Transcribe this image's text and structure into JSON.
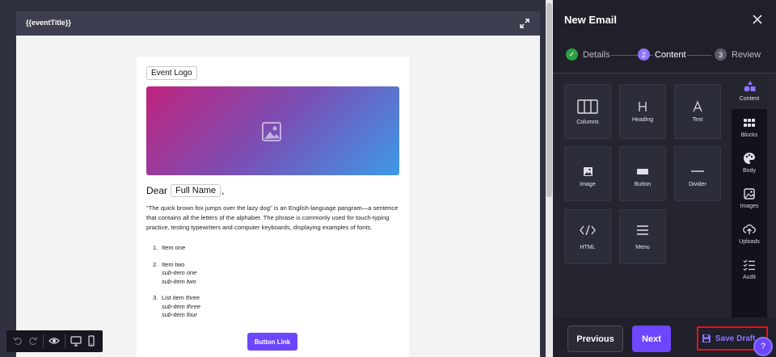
{
  "preview": {
    "title": "{{eventTitle}}",
    "logo_placeholder": "Event Logo",
    "greeting": "Dear",
    "name_placeholder": "Full Name",
    "greeting_suffix": ",",
    "paragraph": "\"The quick brown fox jumps over the lazy dog\" is an English-language pangram—a sentence that contains all the letters of the alphabet. The phrase is commonly used for touch-typing practice, testing typewriters and computer keyboards, displaying examples of fonts.",
    "list": [
      {
        "num": "1.",
        "text": "Item one",
        "subs": []
      },
      {
        "num": "2.",
        "text": "Item two",
        "subs": [
          "sub-item one",
          "sub-item two"
        ]
      },
      {
        "num": "3.",
        "text": "List item three",
        "subs": [
          "sub-item three",
          "sub-item four"
        ]
      }
    ],
    "button_label": "Button Link"
  },
  "panel": {
    "title": "New Email",
    "steps": [
      {
        "num": "✓",
        "label": "Details",
        "state": "done"
      },
      {
        "num": "2",
        "label": "Content",
        "state": "active"
      },
      {
        "num": "3",
        "label": "Review",
        "state": "upcoming"
      }
    ],
    "tiles": [
      {
        "label": "Columns",
        "icon": "columns-icon"
      },
      {
        "label": "Heading",
        "icon": "heading-icon"
      },
      {
        "label": "Text",
        "icon": "text-icon"
      },
      {
        "label": "Image",
        "icon": "image-icon"
      },
      {
        "label": "Button",
        "icon": "button-icon"
      },
      {
        "label": "Divider",
        "icon": "divider-icon"
      },
      {
        "label": "HTML",
        "icon": "html-icon"
      },
      {
        "label": "Menu",
        "icon": "menu-icon"
      }
    ],
    "sidebar": [
      {
        "label": "Content",
        "icon": "shapes-icon",
        "active": true
      },
      {
        "label": "Blocks",
        "icon": "grid-icon",
        "active": false
      },
      {
        "label": "Body",
        "icon": "palette-icon",
        "active": false
      },
      {
        "label": "Images",
        "icon": "images-icon",
        "active": false
      },
      {
        "label": "Uploads",
        "icon": "upload-icon",
        "active": false
      },
      {
        "label": "Audit",
        "icon": "checklist-icon",
        "active": false
      }
    ],
    "footer": {
      "previous": "Previous",
      "next": "Next",
      "save_draft": "Save Draft",
      "help": "?"
    }
  },
  "colors": {
    "accent": "#6c47ff",
    "success": "#2ea043",
    "highlight": "#e1141b"
  }
}
